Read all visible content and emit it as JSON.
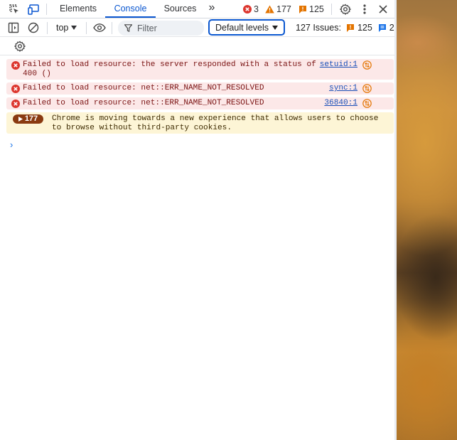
{
  "tabs": [
    {
      "label": "Elements"
    },
    {
      "label": "Console"
    },
    {
      "label": "Sources"
    }
  ],
  "more_tabs_glyph": "»",
  "counts": {
    "errors": "3",
    "warnings": "177",
    "issues": "125"
  },
  "toolbar": {
    "context": "top",
    "filter_placeholder": "Filter",
    "levels": "Default levels",
    "issues_label": "127 Issues:",
    "issues_warnings": "125",
    "issues_info": "2"
  },
  "messages": [
    {
      "type": "error",
      "line1": "Failed to load resource: the server responded with a status of",
      "line2": "400 ()",
      "source": "setuid:1"
    },
    {
      "type": "error",
      "line1": "Failed to load resource: net::ERR_NAME_NOT_RESOLVED",
      "source": "sync:1"
    },
    {
      "type": "error",
      "line1": "Failed to load resource: net::ERR_NAME_NOT_RESOLVED",
      "source": "36840:1"
    },
    {
      "type": "warning",
      "badge": "177",
      "line1": "Chrome is moving towards a new experience that allows users to choose",
      "line2": "to browse without third-party cookies."
    }
  ],
  "prompt_glyph": "›",
  "colors": {
    "accent": "#0b57d0",
    "error": "#dc362e",
    "warning": "#e37400"
  }
}
